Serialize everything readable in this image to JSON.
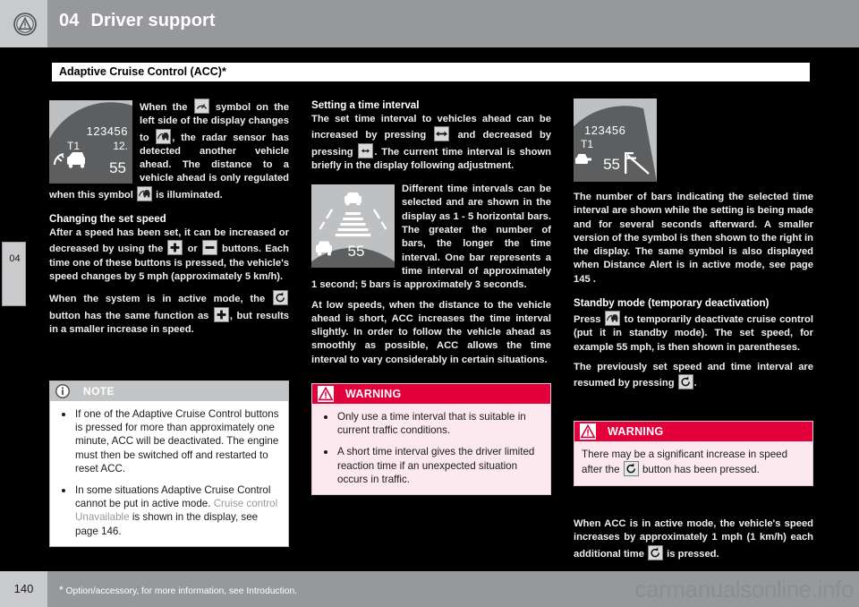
{
  "header": {
    "chapter_number": "04",
    "title": "Driver support",
    "icon": "warning-triangle-circle-icon"
  },
  "chapter_tab": {
    "label": "04"
  },
  "section": {
    "title": "Adaptive Cruise Control (ACC)*"
  },
  "column1": {
    "figure1": {
      "name": "instrument-cluster-acc-active",
      "digits": "123456",
      "gear": "T1",
      "odometer": "12.",
      "speed": "55"
    },
    "para1_a": "When the ",
    "para1_b": " symbol on the left side of the display changes to ",
    "para1_c": ", the radar sensor has detected another vehicle ahead. The distance to a vehicle ahead is only regulated when this symbol ",
    "para1_d": " is illuminated.",
    "heading2": "Changing the set speed",
    "para2_a": "After a speed has been set, it can be increased or decreased by using the ",
    "para2_b": " or ",
    "para2_c": " buttons. Each time one of these buttons is pressed, the vehicle's speed changes by 5 mph (approximately 5 km/h).",
    "para3_a": "When the system is in active mode, the ",
    "para3_b": " button has the same function as ",
    "para3_c": ", but results in a smaller increase in speed.",
    "note": {
      "label": "NOTE",
      "icon": "info-circle-icon",
      "bullets": [
        "If one of the Adaptive Cruise Control buttons is pressed for more than approximately one minute, ACC will be deactivated. The engine must then be switched off and restarted to reset ACC.",
        "In some situations Adaptive Cruise Control cannot be put in active mode. Cruise control Unavailable is shown in the display, see page 146."
      ],
      "bullet2_pre": "In some situations Adaptive Cruise Control cannot be put in active mode. ",
      "bullet2_em": "Cruise control Unavailable",
      "bullet2_post": " is shown in the display, see page 146."
    }
  },
  "column2": {
    "heading1": "Setting a time interval",
    "para1_a": "The set time interval to vehicles ahead can be increased by pressing ",
    "para1_b": " and decreased by pressing ",
    "para1_c": ". The current time interval is shown briefly in the display following adjustment.",
    "figure2": {
      "name": "time-interval-bars-display",
      "speed": "55"
    },
    "para2": "Different time intervals can be selected and are shown in the display as 1 - 5 horizontal bars. The greater the number of bars, the longer the time interval. One bar represents a time interval of approximately 1 second; 5 bars is approximately 3 seconds.",
    "para3": "At low speeds, when the distance to the vehicle ahead is short, ACC increases the time interval slightly. In order to follow the vehicle ahead as smoothly as possible, ACC allows the time interval to vary considerably in certain situations.",
    "warning": {
      "label": "WARNING",
      "icon": "warning-triangle-icon",
      "bullets": [
        "Only use a time interval that is suitable in current traffic conditions.",
        "A short time interval gives the driver limited reaction time if an unexpected situation occurs in traffic."
      ]
    }
  },
  "column3": {
    "figure3": {
      "name": "instrument-cluster-small-interval-symbol",
      "digits": "123456",
      "gear": "T1",
      "speed": "55"
    },
    "para1": "The number of bars indicating the selected time interval are shown while the setting is being made and for several seconds afterward. A smaller version of the symbol is then shown to the right in the display. The same symbol is also displayed when Distance Alert is in active mode, see page 145 .",
    "heading1": "Standby mode (temporary deactivation)",
    "para2_a": "Press ",
    "para2_b": " to temporarily deactivate cruise control (put it in standby mode). The set speed, for example 55 mph, is then shown in parentheses.",
    "para3_a": "The previously set speed and time interval are resumed by pressing ",
    "para3_b": ".",
    "warning": {
      "label": "WARNING",
      "icon": "warning-triangle-icon",
      "text_a": "There may be a significant increase in speed after the ",
      "text_b": " button has been pressed."
    },
    "para4_a": "When ACC is in active mode, the vehicle's speed increases by approximately 1 mph (1 km/h) each additional time ",
    "para4_b": " is pressed."
  },
  "footer": {
    "page_number": "140",
    "note_star": "*",
    "note_text": "Option/accessory, for more information, see Introduction.",
    "watermark": "carmanualsonline.info"
  },
  "colors": {
    "header_bg": "#96989b",
    "header_left_bg": "#c9cacc",
    "warning_red": "#e4003a",
    "warning_bg": "#fce9ef",
    "note_head_bg": "#c3c4c6",
    "page_bg": "#000000",
    "figure_bg": "#bfc0c2",
    "figure_dial": "#5c5e60"
  }
}
